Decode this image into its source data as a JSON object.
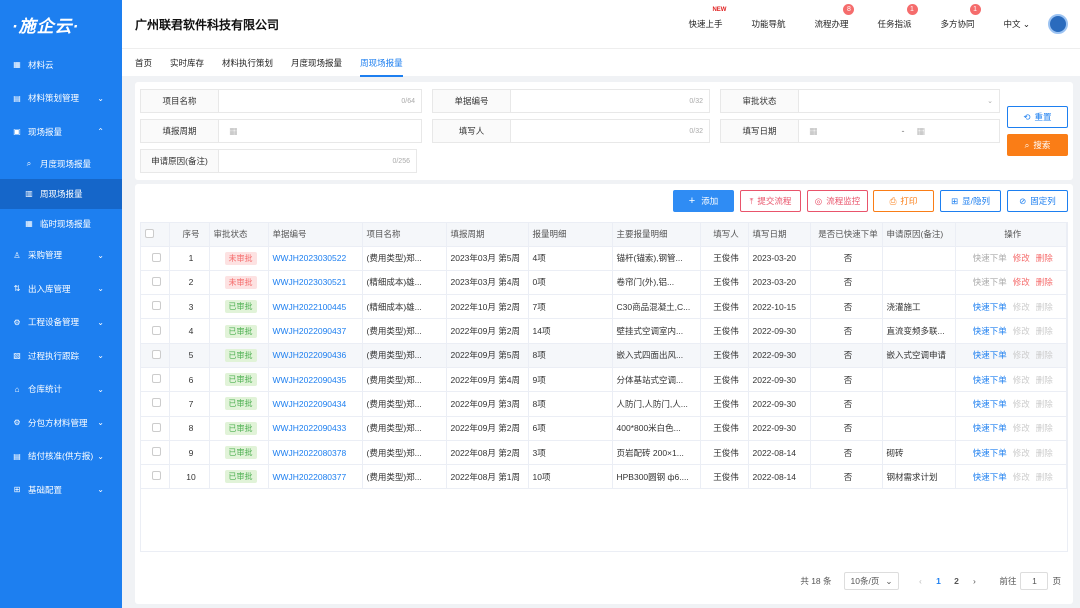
{
  "app": {
    "logo": "·施企云·",
    "company": "广州联君软件科技有限公司"
  },
  "sidebar": {
    "items": [
      {
        "label": "材料云",
        "icon": "grid-icon",
        "chev": ""
      },
      {
        "label": "材料策划管理",
        "icon": "doc-icon",
        "chev": "⌄"
      },
      {
        "label": "现场报量",
        "icon": "report-icon",
        "chev": "⌃"
      },
      {
        "label": "月度现场报量",
        "icon": "search-doc-icon",
        "chev": "",
        "sub": true
      },
      {
        "label": "周现场报量",
        "icon": "table-icon",
        "chev": "",
        "sub": true,
        "active": true
      },
      {
        "label": "临时现场报量",
        "icon": "calc-icon",
        "chev": "",
        "sub": true
      },
      {
        "label": "采购管理",
        "icon": "user-icon",
        "chev": "⌄"
      },
      {
        "label": "出入库管理",
        "icon": "box-icon",
        "chev": "⌄"
      },
      {
        "label": "工程设备管理",
        "icon": "gear-icon",
        "chev": "⌄"
      },
      {
        "label": "过程执行跟踪",
        "icon": "track-icon",
        "chev": "⌄"
      },
      {
        "label": "仓库统计",
        "icon": "warehouse-icon",
        "chev": "⌄"
      },
      {
        "label": "分包方材料管理",
        "icon": "settings-icon",
        "chev": "⌄"
      },
      {
        "label": "结付核准(供方报)",
        "icon": "check-icon",
        "chev": "⌄"
      },
      {
        "label": "基础配置",
        "icon": "apps-icon",
        "chev": "⌄"
      }
    ]
  },
  "top": {
    "links": [
      {
        "label": "快速上手",
        "badge": "",
        "new": "NEW"
      },
      {
        "label": "功能导航",
        "badge": "",
        "new": ""
      },
      {
        "label": "流程办理",
        "badge": "8",
        "new": ""
      },
      {
        "label": "任务指派",
        "badge": "1",
        "new": ""
      },
      {
        "label": "多方协同",
        "badge": "1",
        "new": ""
      }
    ],
    "lang": "中文 ⌄"
  },
  "tabs": [
    "首页",
    "实时库存",
    "材料执行策划",
    "月度现场报量",
    "周现场报量"
  ],
  "filters": {
    "project_name": "项目名称",
    "project_count": "0/64",
    "doc_no": "单据编号",
    "doc_count": "0/32",
    "status": "审批状态",
    "period": "填报周期",
    "filler": "填写人",
    "filler_count": "0/32",
    "date": "填写日期",
    "date_sep": "-",
    "reason": "申请原因(备注)",
    "reason_count": "0/256",
    "reset": "重置",
    "search": "搜索"
  },
  "toolbar": {
    "add": "添加",
    "submit": "提交流程",
    "monitor": "流程监控",
    "print": "打印",
    "toggle": "显/隐列",
    "fix": "固定列"
  },
  "table": {
    "headers": [
      "序号",
      "审批状态",
      "单据编号",
      "项目名称",
      "填报周期",
      "报量明细",
      "主要报量明细",
      "填写人",
      "填写日期",
      "是否已快速下单",
      "申请原因(备注)",
      "操作"
    ],
    "rows": [
      {
        "no": "1",
        "status": "未审批",
        "code": "WWJH2023030522",
        "proj": "(费用类型)郑...",
        "period": "2023年03月 第5周",
        "items": "4项",
        "main": "锚杆(锚索),钢管...",
        "user": "王俊伟",
        "date": "2023-03-20",
        "quick": "否",
        "reason": "",
        "ops": [
          "快速下单",
          "修改",
          "删除"
        ],
        "approved": false
      },
      {
        "no": "2",
        "status": "未审批",
        "code": "WWJH2023030521",
        "proj": "(精细成本)雄...",
        "period": "2023年03月 第4周",
        "items": "0项",
        "main": "卷帘门(外),铝...",
        "user": "王俊伟",
        "date": "2023-03-20",
        "quick": "否",
        "reason": "",
        "ops": [
          "快速下单",
          "修改",
          "删除"
        ],
        "approved": false
      },
      {
        "no": "3",
        "status": "已审批",
        "code": "WWJH2022100445",
        "proj": "(精细成本)雄...",
        "period": "2022年10月 第2周",
        "items": "7项",
        "main": "C30商品混凝土,C...",
        "user": "王俊伟",
        "date": "2022-10-15",
        "quick": "否",
        "reason": "浇灌施工",
        "ops": [
          "快速下单",
          "修改",
          "删除"
        ],
        "approved": true
      },
      {
        "no": "4",
        "status": "已审批",
        "code": "WWJH2022090437",
        "proj": "(费用类型)郑...",
        "period": "2022年09月 第2周",
        "items": "14项",
        "main": "壁挂式空调室内...",
        "user": "王俊伟",
        "date": "2022-09-30",
        "quick": "否",
        "reason": "直流变频多联...",
        "ops": [
          "快速下单",
          "修改",
          "删除"
        ],
        "approved": true
      },
      {
        "no": "5",
        "status": "已审批",
        "code": "WWJH2022090436",
        "proj": "(费用类型)郑...",
        "period": "2022年09月 第5周",
        "items": "8项",
        "main": "嵌入式四面出风...",
        "user": "王俊伟",
        "date": "2022-09-30",
        "quick": "否",
        "reason": "嵌入式空调申请",
        "ops": [
          "快速下单",
          "修改",
          "删除"
        ],
        "approved": true
      },
      {
        "no": "6",
        "status": "已审批",
        "code": "WWJH2022090435",
        "proj": "(费用类型)郑...",
        "period": "2022年09月 第4周",
        "items": "9项",
        "main": "分体基站式空调...",
        "user": "王俊伟",
        "date": "2022-09-30",
        "quick": "否",
        "reason": "",
        "ops": [
          "快速下单",
          "修改",
          "删除"
        ],
        "approved": true
      },
      {
        "no": "7",
        "status": "已审批",
        "code": "WWJH2022090434",
        "proj": "(费用类型)郑...",
        "period": "2022年09月 第3周",
        "items": "8项",
        "main": "人防门,人防门,人...",
        "user": "王俊伟",
        "date": "2022-09-30",
        "quick": "否",
        "reason": "",
        "ops": [
          "快速下单",
          "修改",
          "删除"
        ],
        "approved": true
      },
      {
        "no": "8",
        "status": "已审批",
        "code": "WWJH2022090433",
        "proj": "(费用类型)郑...",
        "period": "2022年09月 第2周",
        "items": "6项",
        "main": "400*800米白色...",
        "user": "王俊伟",
        "date": "2022-09-30",
        "quick": "否",
        "reason": "",
        "ops": [
          "快速下单",
          "修改",
          "删除"
        ],
        "approved": true
      },
      {
        "no": "9",
        "status": "已审批",
        "code": "WWJH2022080378",
        "proj": "(费用类型)郑...",
        "period": "2022年08月 第2周",
        "items": "3项",
        "main": "页岩配砖 200×1...",
        "user": "王俊伟",
        "date": "2022-08-14",
        "quick": "否",
        "reason": "砌砖",
        "ops": [
          "快速下单",
          "修改",
          "删除"
        ],
        "approved": true
      },
      {
        "no": "10",
        "status": "已审批",
        "code": "WWJH2022080377",
        "proj": "(费用类型)郑...",
        "period": "2022年08月 第1周",
        "items": "10项",
        "main": "HPB300圆钢 ф6....",
        "user": "王俊伟",
        "date": "2022-08-14",
        "quick": "否",
        "reason": "钢材需求计划",
        "ops": [
          "快速下单",
          "修改",
          "删除"
        ],
        "approved": true
      }
    ]
  },
  "pager": {
    "total": "共 18 条",
    "size": "10条/页",
    "p1": "1",
    "p2": "2",
    "goto": "前往",
    "page": "1",
    "unit": "页",
    "prev": "‹",
    "next": "›"
  }
}
